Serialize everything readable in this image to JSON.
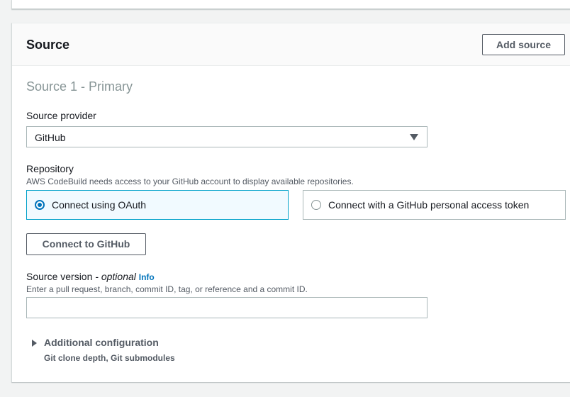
{
  "panel": {
    "title": "Source",
    "add_source_label": "Add source"
  },
  "source1": {
    "title": "Source 1 - Primary",
    "provider_label": "Source provider",
    "provider_value": "GitHub",
    "repository_label": "Repository",
    "repository_desc": "AWS CodeBuild needs access to your GitHub account to display available repositories.",
    "options": [
      {
        "label": "Connect using OAuth",
        "selected": true
      },
      {
        "label": "Connect with a GitHub personal access token",
        "selected": false
      }
    ],
    "connect_button": "Connect to GitHub",
    "version_label": "Source version",
    "version_optional": "- optional",
    "version_info": "Info",
    "version_desc": "Enter a pull request, branch, commit ID, tag, or reference and a commit ID.",
    "version_value": "",
    "additional_config_title": "Additional configuration",
    "additional_config_desc": "Git clone depth, Git submodules"
  },
  "colors": {
    "accent": "#0073bb",
    "selected_border": "#00a1c9",
    "selected_bg": "#f1faff"
  }
}
